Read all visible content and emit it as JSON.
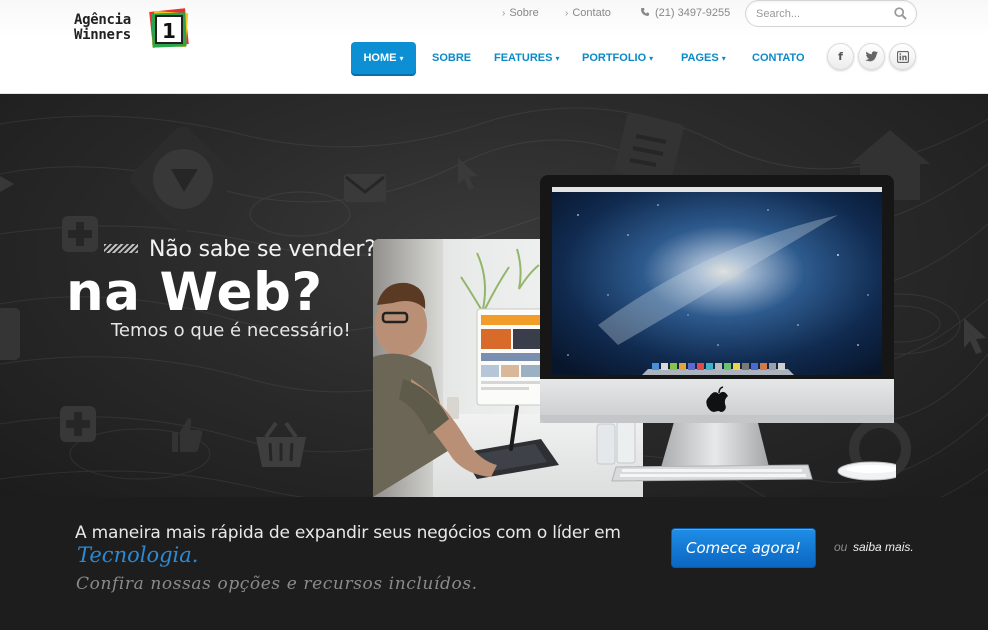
{
  "brand": {
    "line1": "Agência",
    "line2": "Winners",
    "badge_number": "1"
  },
  "topbar": {
    "about": "Sobre",
    "contact": "Contato",
    "phone": "(21) 3497-9255"
  },
  "search": {
    "placeholder": "Search..."
  },
  "nav": {
    "home": "HOME",
    "about": "SOBRE",
    "features": "FEATURES",
    "portfolio": "PORTFOLIO",
    "pages": "PAGES",
    "contact": "CONTATO"
  },
  "social": {
    "facebook": "f",
    "twitter": "t",
    "linkedin": "in"
  },
  "hero": {
    "line1": "Não sabe se vender?",
    "line2": "na Web?",
    "line3": "Temos o que é necessário!"
  },
  "cta": {
    "text": "A maneira mais rápida de expandir seus negócios com o líder em",
    "highlight": "Tecnologia.",
    "sub": "Confira nossas opções e recursos incluídos.",
    "button": "Comece agora!",
    "or": "ou",
    "more": "saiba mais."
  },
  "colors": {
    "accent": "#0d8fd3",
    "nav_text": "#0a8bc8",
    "cta_highlight": "#2a8ad6",
    "button": "#0b66c2"
  }
}
